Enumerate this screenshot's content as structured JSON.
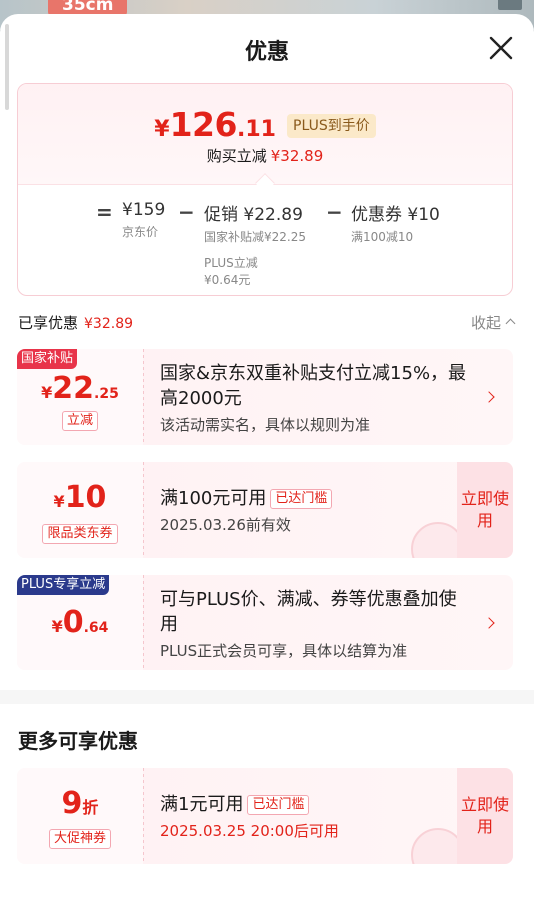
{
  "background": {
    "banner_text": "35cm"
  },
  "header": {
    "title": "优惠"
  },
  "summary": {
    "price_symbol": "¥",
    "price_int": "126",
    "price_dec": ".11",
    "price_tag": "PLUS到手价",
    "save_label": "购买立减",
    "save_amount": "¥32.89",
    "breakdown": {
      "eq": "=",
      "minus": "−",
      "jd_value": "¥159",
      "jd_label": "京东价",
      "promo_value": "促销 ¥22.89",
      "promo_sub1": "国家补贴减¥22.25",
      "promo_sub2a": "PLUS立减",
      "promo_sub2b": "¥0.64元",
      "coupon_value": "优惠券 ¥10",
      "coupon_sub": "满100减10"
    }
  },
  "enjoyed": {
    "label": "已享优惠",
    "amount": "¥32.89",
    "collapse_label": "收起"
  },
  "cards": [
    {
      "tag": "国家补贴",
      "sym": "¥",
      "big": "22",
      "small": ".25",
      "sub": "立减",
      "title": "国家&京东双重补贴支付立减15%，最高2000元",
      "desc": "该活动需实名，具体以规则为准"
    },
    {
      "sym": "¥",
      "big": "10",
      "sub": "限品类东券",
      "title": "满100元可用",
      "badge": "已达门槛",
      "desc": "2025.03.26前有效",
      "use_label": "立即使用"
    },
    {
      "tag": "PLUS专享立减",
      "sym": "¥",
      "big": "0",
      "small": ".64",
      "title": "可与PLUS价、满减、券等优惠叠加使用",
      "desc": "PLUS正式会员可享，具体以结算为准"
    }
  ],
  "more": {
    "title": "更多可享优惠",
    "card": {
      "big": "9",
      "unit": "折",
      "sub": "大促神券",
      "title": "满1元可用",
      "badge": "已达门槛",
      "desc": "2025.03.25 20:00后可用",
      "use_label": "立即使用"
    }
  },
  "colors": {
    "accent": "#e2231a",
    "plus_gold": "#fbe9c9",
    "card_bg": "#fff1f3",
    "navy_tag": "#2b3a8c"
  }
}
